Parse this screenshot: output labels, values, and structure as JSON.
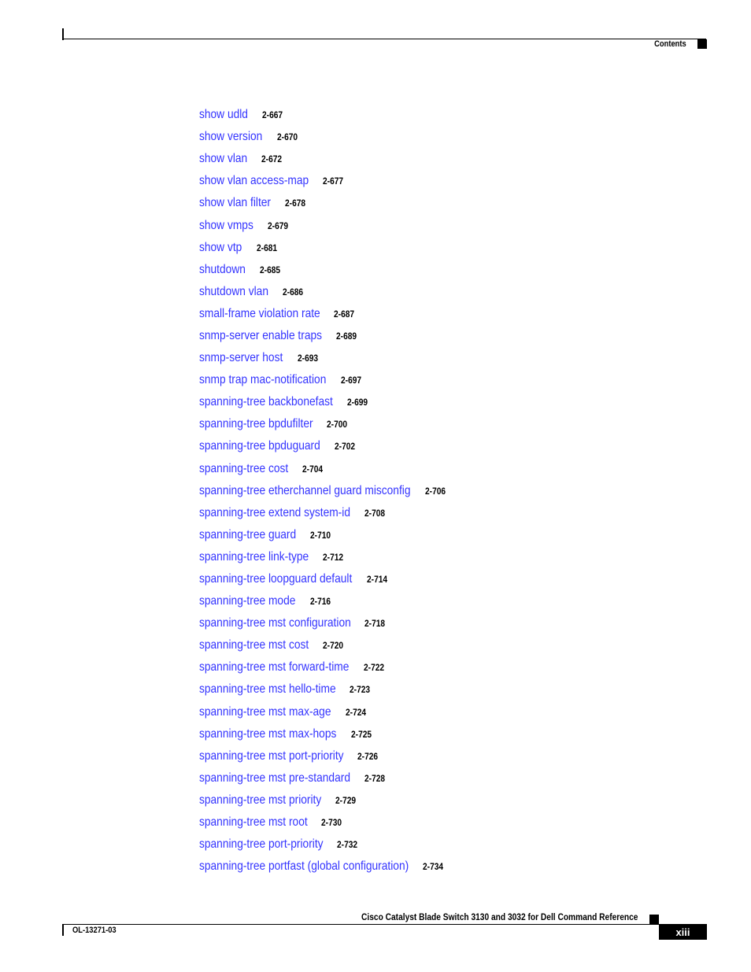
{
  "header": {
    "section_label": "Contents"
  },
  "toc": [
    {
      "title": "show udld",
      "page": "2-667"
    },
    {
      "title": "show version",
      "page": "2-670"
    },
    {
      "title": "show vlan",
      "page": "2-672"
    },
    {
      "title": "show vlan access-map",
      "page": "2-677"
    },
    {
      "title": "show vlan filter",
      "page": "2-678"
    },
    {
      "title": "show vmps",
      "page": "2-679"
    },
    {
      "title": "show vtp",
      "page": "2-681"
    },
    {
      "title": "shutdown",
      "page": "2-685"
    },
    {
      "title": "shutdown vlan",
      "page": "2-686"
    },
    {
      "title": "small-frame violation rate",
      "page": "2-687"
    },
    {
      "title": "snmp-server enable traps",
      "page": "2-689"
    },
    {
      "title": "snmp-server host",
      "page": "2-693"
    },
    {
      "title": "snmp trap mac-notification",
      "page": "2-697"
    },
    {
      "title": "spanning-tree backbonefast",
      "page": "2-699"
    },
    {
      "title": "spanning-tree bpdufilter",
      "page": "2-700"
    },
    {
      "title": "spanning-tree bpduguard",
      "page": "2-702"
    },
    {
      "title": "spanning-tree cost",
      "page": "2-704"
    },
    {
      "title": "spanning-tree etherchannel guard misconfig",
      "page": "2-706"
    },
    {
      "title": "spanning-tree extend system-id",
      "page": "2-708"
    },
    {
      "title": "spanning-tree guard",
      "page": "2-710"
    },
    {
      "title": "spanning-tree link-type",
      "page": "2-712"
    },
    {
      "title": "spanning-tree loopguard default",
      "page": "2-714"
    },
    {
      "title": "spanning-tree mode",
      "page": "2-716"
    },
    {
      "title": "spanning-tree mst configuration",
      "page": "2-718"
    },
    {
      "title": "spanning-tree mst cost",
      "page": "2-720"
    },
    {
      "title": "spanning-tree mst forward-time",
      "page": "2-722"
    },
    {
      "title": "spanning-tree mst hello-time",
      "page": "2-723"
    },
    {
      "title": "spanning-tree mst max-age",
      "page": "2-724"
    },
    {
      "title": "spanning-tree mst max-hops",
      "page": "2-725"
    },
    {
      "title": "spanning-tree mst port-priority",
      "page": "2-726"
    },
    {
      "title": "spanning-tree mst pre-standard",
      "page": "2-728"
    },
    {
      "title": "spanning-tree mst priority",
      "page": "2-729"
    },
    {
      "title": "spanning-tree mst root",
      "page": "2-730"
    },
    {
      "title": "spanning-tree port-priority",
      "page": "2-732"
    },
    {
      "title": "spanning-tree portfast (global configuration)",
      "page": "2-734"
    }
  ],
  "footer": {
    "book_title": "Cisco Catalyst Blade Switch 3130 and 3032 for Dell Command Reference",
    "doc_number": "OL-13271-03",
    "page_number": "xiii"
  },
  "colors": {
    "link": "#3333ff",
    "text": "#000000"
  }
}
